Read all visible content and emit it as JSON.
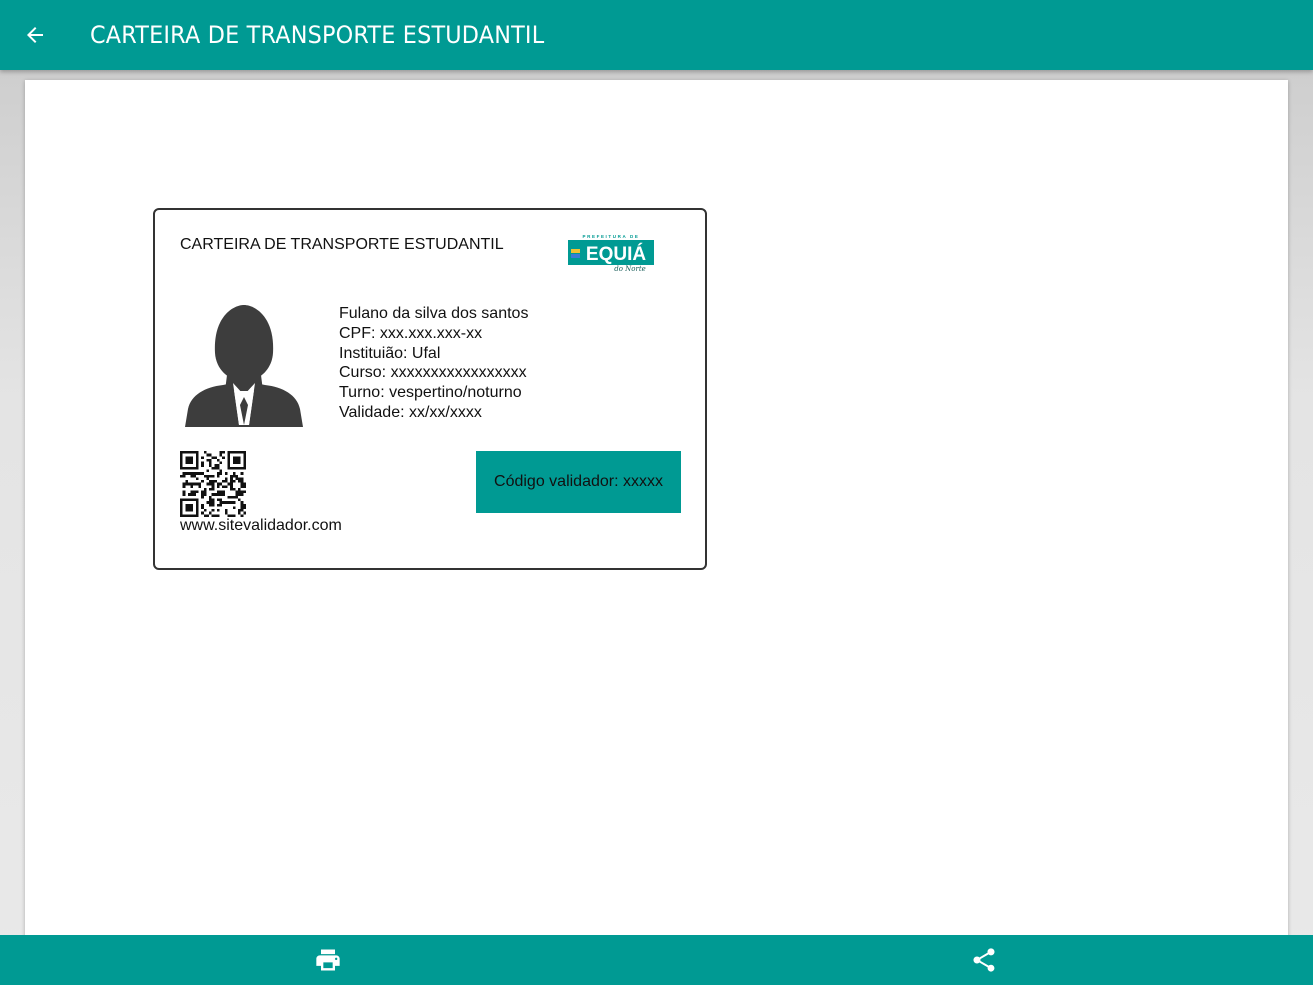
{
  "app_bar": {
    "title": "CARTEIRA DE TRANSPORTE ESTUDANTIL",
    "back_icon": "arrow-back-icon",
    "background": "#009a93"
  },
  "card": {
    "title": "CARTEIRA DE TRANSPORTE ESTUDANTIL",
    "logo": {
      "top_text": "PREFEITURA DE",
      "main_text": "EQUIÁ",
      "script_text": "do Norte",
      "color": "#009a93"
    },
    "avatar_icon": "person-silhouette-icon",
    "student": {
      "name": "Fulano da silva dos santos",
      "cpf": "CPF: xxx.xxx.xxx-xx",
      "institution": "Instituião: Ufal",
      "course": "Curso: xxxxxxxxxxxxxxxxx",
      "shift": "Turno: vespertino/noturno",
      "validity": "Validade: xx/xx/xxxx"
    },
    "qr_icon": "qr-code-icon",
    "site": "www.sitevalidador.com",
    "validator_code": "Código validador: xxxxx",
    "accent": "#009a93"
  },
  "bottom_bar": {
    "print_icon": "print-icon",
    "share_icon": "share-icon",
    "background": "#009a93"
  }
}
